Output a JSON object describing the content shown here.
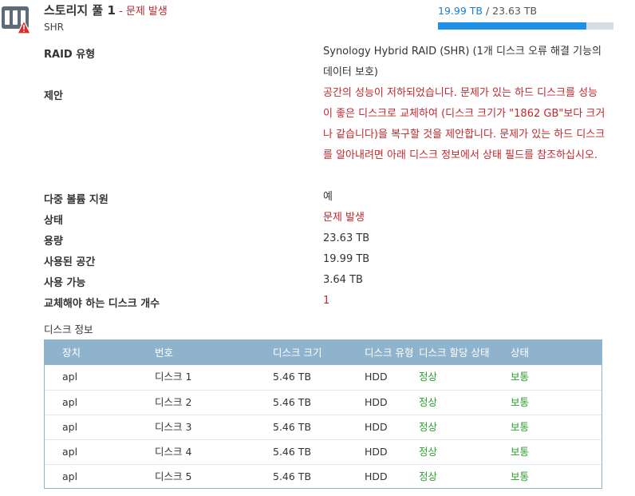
{
  "header": {
    "title": "스토리지 풀 1",
    "status_text": "문제 발생",
    "subtitle": "SHR",
    "usage_used": "19.99 TB",
    "usage_total": "23.63 TB",
    "usage_fraction": 0.846
  },
  "details": {
    "raid_label": "RAID 유형",
    "raid_value": "Synology Hybrid RAID (SHR) (1개 디스크 오류 해결 기능의 데이터 보호)",
    "suggestion_label": "제안",
    "suggestion_value": "공간의 성능이 저하되었습니다. 문제가 있는 하드 디스크를 성능이 좋은 디스크로 교체하여 (디스크 크기가 \"1862 GB\"보다 크거나 같습니다)을 복구할 것을 제안합니다. 문제가 있는 하드 디스크를 알아내려면 아래 디스크 정보에서 상태 필드를 참조하십시오.",
    "multi_volume_label": "다중 볼륨 지원",
    "multi_volume_value": "예",
    "status_label": "상태",
    "status_value": "문제 발생",
    "capacity_label": "용량",
    "capacity_value": "23.63 TB",
    "used_label": "사용된 공간",
    "used_value": "19.99 TB",
    "available_label": "사용 가능",
    "available_value": "3.64 TB",
    "replace_label": "교체해야 하는 디스크 개수",
    "replace_value": "1"
  },
  "disk_section": {
    "title": "디스크 정보",
    "columns": [
      "장치",
      "번호",
      "디스크 크기",
      "디스크 유형",
      "디스크 할당 상태",
      "상태"
    ],
    "rows": [
      {
        "device": "apl",
        "number": "디스크 1",
        "size": "5.46 TB",
        "type": "HDD",
        "alloc": "정상",
        "status": "보통"
      },
      {
        "device": "apl",
        "number": "디스크 2",
        "size": "5.46 TB",
        "type": "HDD",
        "alloc": "정상",
        "status": "보통"
      },
      {
        "device": "apl",
        "number": "디스크 3",
        "size": "5.46 TB",
        "type": "HDD",
        "alloc": "정상",
        "status": "보통"
      },
      {
        "device": "apl",
        "number": "디스크 4",
        "size": "5.46 TB",
        "type": "HDD",
        "alloc": "정상",
        "status": "보통"
      },
      {
        "device": "apl",
        "number": "디스크 5",
        "size": "5.46 TB",
        "type": "HDD",
        "alloc": "정상",
        "status": "보통"
      }
    ]
  },
  "colors": {
    "error": "#c0282d",
    "ok": "#2a9d2a",
    "accent": "#1e90e8",
    "table_header": "#8fb3cc"
  },
  "icons": {
    "pool": "storage-pool-icon",
    "warning": "warning-icon"
  }
}
